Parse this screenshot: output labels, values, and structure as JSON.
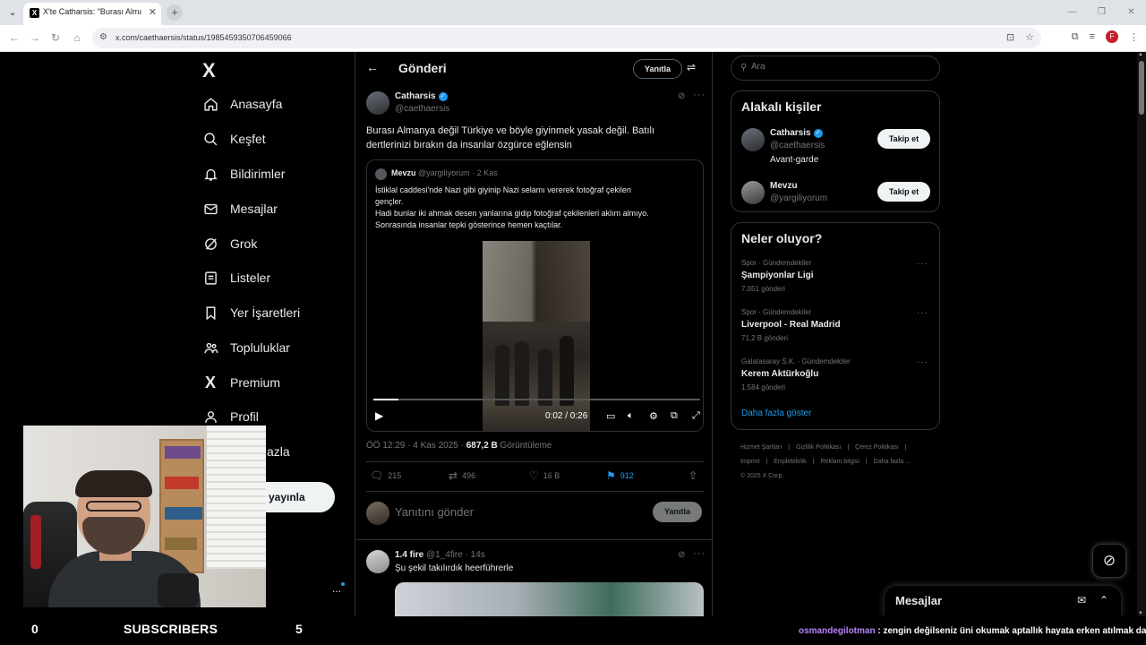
{
  "browser": {
    "tab_title": "X'te Catharsis: \"Burası Almanya",
    "tab_close": "✕",
    "new_tab": "+",
    "url": "x.com/caethaersis/status/1985459350706459066"
  },
  "nav": {
    "logo": "X",
    "items": [
      {
        "label": "Anasayfa",
        "icon": "home-icon"
      },
      {
        "label": "Keşfet",
        "icon": "search-icon"
      },
      {
        "label": "Bildirimler",
        "icon": "bell-icon"
      },
      {
        "label": "Mesajlar",
        "icon": "envelope-icon"
      },
      {
        "label": "Grok",
        "icon": "grok-icon"
      },
      {
        "label": "Listeler",
        "icon": "list-icon"
      },
      {
        "label": "Yer İşaretleri",
        "icon": "bookmark-icon"
      },
      {
        "label": "Topluluklar",
        "icon": "people-icon"
      },
      {
        "label": "Premium",
        "icon": "x-icon"
      },
      {
        "label": "Profil",
        "icon": "person-icon"
      },
      {
        "label": "azla",
        "icon": "more-icon"
      }
    ],
    "post_button": "yayınla",
    "more": "..."
  },
  "header": {
    "title": "Gönderi",
    "reply_button": "Yanıtla"
  },
  "tweet": {
    "name": "Catharsis",
    "handle": "@caethaersis",
    "text": "Burası Almanya değil Türkiye ve böyle giyinmek yasak değil. Batılı dertlerinizi bırakın da insanlar özgürce eğlensin",
    "quote": {
      "name": "Mevzu",
      "handle": "@yargiliyorum",
      "date": "· 2 Kas",
      "text_lines": [
        "İstiklal caddesi'nde Nazi gibi giyinip Nazi selamı vererek fotoğraf çekilen",
        "gençler.",
        "Hadi bunlar iki ahmak desen yanlarına gidip fotoğraf çekilenleri aklım almıyo.",
        "Sonrasında insanlar tepki gösterince hemen kaçtılar."
      ],
      "video": {
        "time": "0:02 / 0:26",
        "progress": 0.077
      }
    },
    "meta_time": "ÖÖ 12:29 · 4 Kas 2025 · ",
    "views_value": "687,2 B",
    "views_label": " Görüntüleme",
    "stats": {
      "replies": "215",
      "retweets": "496",
      "likes": "16 B",
      "bookmarks": "912"
    },
    "compose_placeholder": "Yanıtını gönder",
    "compose_button": "Yanıtla"
  },
  "reply": {
    "name": "1.4 fire",
    "handle": " @1_4fire · 14s",
    "text": "Şu şekil takılırdık heerführerle"
  },
  "search": {
    "placeholder": "Ara"
  },
  "people_panel": {
    "title": "Alakalı kişiler",
    "people": [
      {
        "name": "Catharsis",
        "handle": "@caethaersis",
        "bio": "Avant-garde",
        "button": "Takip et"
      },
      {
        "name": "Mevzu",
        "handle": "@yargiliyorum",
        "bio": "",
        "button": "Takip et"
      }
    ]
  },
  "trends_panel": {
    "title": "Neler oluyor?",
    "trends": [
      {
        "category": "Spor · Gündemdekiler",
        "name": "Şampiyonlar Ligi",
        "count": "7.051 gönderi"
      },
      {
        "category": "Spor · Gündemdekiler",
        "name": "Liverpool - Real Madrid",
        "count": "71,2 B gönderi"
      },
      {
        "category": "Galatasaray S.K. · Gündemdekiler",
        "name": "Kerem Aktürkoğlu",
        "count": "1.584 gönderi"
      }
    ],
    "show_more": "Daha fazla göster"
  },
  "footer": {
    "links": [
      "Hizmet Şartları",
      "|",
      "Gizlilik Politikası",
      "|",
      "Çerez Politikası",
      "|",
      "Imprint",
      "|",
      "Erişilebilirlik",
      "|",
      "Reklam bilgisi",
      "|",
      "Daha fazla ...",
      "© 2025 X Corp."
    ]
  },
  "messages_drawer": {
    "title": "Mesajlar"
  },
  "stream": {
    "left_count": "0",
    "subscribers_label": "SUBSCRIBERS",
    "right_count": "5",
    "chat_user": "osmandegilotman",
    "chat_message": " : zengin değilseniz üni okumak aptallık hayata erken atılmak daha iyi"
  },
  "colors": {
    "accent": "#1d9bf0",
    "background": "#000000",
    "border": "#2f3336",
    "muted_text": "#71767b"
  }
}
